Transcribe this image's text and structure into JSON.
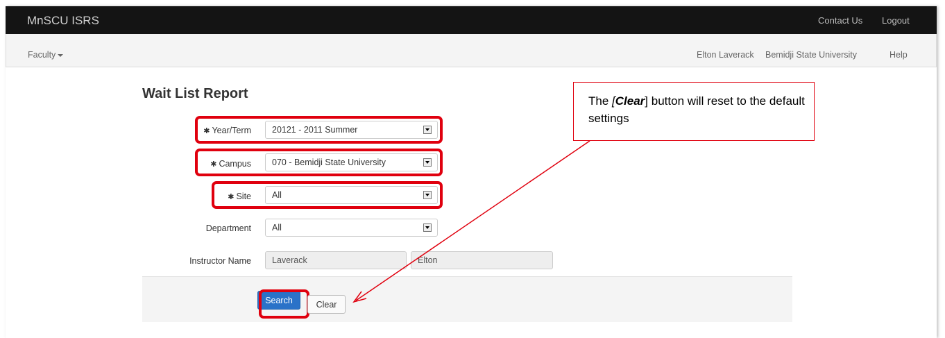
{
  "app": {
    "title": "MnSCU ISRS"
  },
  "topnav": {
    "contact": "Contact Us",
    "logout": "Logout"
  },
  "subnav": {
    "faculty": "Faculty",
    "user": "Elton Laverack",
    "institution": "Bemidji State University",
    "help": "Help"
  },
  "page": {
    "title": "Wait List Report"
  },
  "form": {
    "required_mark": "✱",
    "year_term": {
      "label": "Year/Term",
      "value": "20121 - 2011 Summer"
    },
    "campus": {
      "label": "Campus",
      "value": "070 - Bemidji State University"
    },
    "site": {
      "label": "Site",
      "value": "All"
    },
    "department": {
      "label": "Department",
      "value": "All"
    },
    "instructor": {
      "label": "Instructor Name",
      "last": "Laverack",
      "first": "Elton"
    }
  },
  "buttons": {
    "search": "Search",
    "clear": "Clear"
  },
  "callout": {
    "pre": "The ",
    "bracket_open": "[",
    "strong": "Clear",
    "bracket_close": "]",
    "post": " button will reset to the default settings"
  },
  "colors": {
    "highlight": "#e0000e",
    "primary": "#2a72c8",
    "topbar": "#141414"
  }
}
